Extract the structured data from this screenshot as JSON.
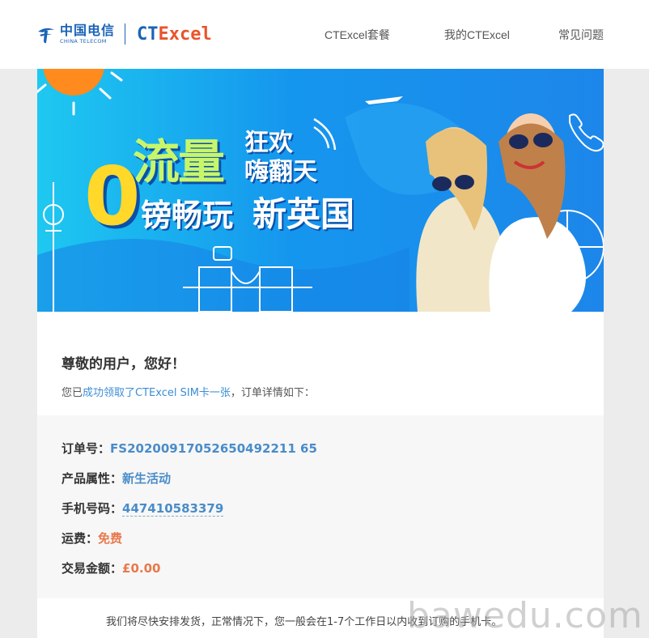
{
  "header": {
    "brand_cn": "中国电信",
    "brand_en": "CHINA TELECOM",
    "product_logo_part1": "CT",
    "product_logo_part2": "Excel",
    "nav": [
      "CTExcel套餐",
      "我的CTExcel",
      "常见问题"
    ]
  },
  "banner": {
    "line1_big": "流量",
    "line1_small_a": "狂欢",
    "line1_small_b": "嗨翻天",
    "line2_zero": "0",
    "line2_text": "镑畅玩",
    "line2_text_b": "新英国"
  },
  "content": {
    "greeting": "尊敬的用户，您好！",
    "intro_prefix": "您已",
    "intro_highlight": "成功领取了CTExcel SIM卡一张",
    "intro_suffix": "，订单详情如下：",
    "order": {
      "order_no_label": "订单号：",
      "order_no_value": "FS20200917052650492211 65",
      "attr_label": "产品属性：",
      "attr_value": "新生活动",
      "phone_label": "手机号码：",
      "phone_value": "447410583379",
      "shipping_label": "运费：",
      "shipping_value": "免费",
      "amount_label": "交易金额：",
      "amount_value": "£0.00"
    },
    "footer_note": "我们将尽快安排发货，正常情况下，您一般会在1-7个工作日以内收到订购的手机卡。"
  },
  "watermark": "bawedu.com",
  "colors": {
    "brand_blue": "#1a63b6",
    "accent_orange": "#e8542c",
    "link_blue": "#3c8dd6",
    "value_blue": "#4a8cc9",
    "value_orange": "#e8794b"
  }
}
